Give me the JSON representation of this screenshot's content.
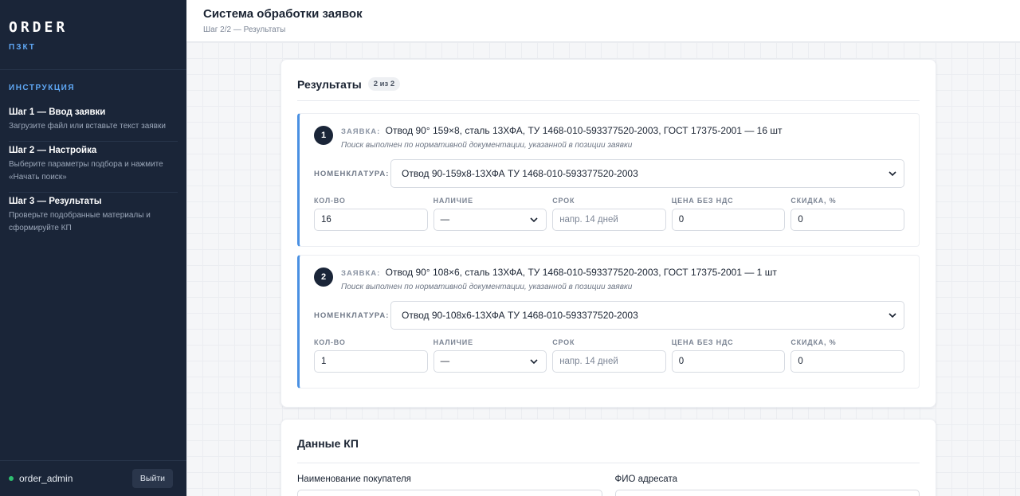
{
  "sidebar": {
    "brand_title": "ORDER",
    "brand_subtitle": "ПЗКТ",
    "instructions_title": "ИНСТРУКЦИЯ",
    "steps": [
      {
        "title": "Шаг 1 — Ввод заявки",
        "desc": "Загрузите файл или вставьте текст заявки"
      },
      {
        "title": "Шаг 2 — Настройка",
        "desc": "Выберите параметры подбора и нажмите «Начать поиск»"
      },
      {
        "title": "Шаг 3 — Результаты",
        "desc": "Проверьте подобранные материалы и сформируйте КП"
      }
    ],
    "user": "order_admin",
    "logout_label": "Выйти"
  },
  "header": {
    "title": "Система обработки заявок",
    "breadcrumb": "Шаг 2/2 — Результаты"
  },
  "results": {
    "title": "Результаты",
    "badge": "2 из 2",
    "request_label": "ЗАЯВКА:",
    "nomenclature_label": "НОМЕНКЛАТУРА:",
    "field_labels": {
      "qty": "КОЛ-ВО",
      "availability": "НАЛИЧИЕ",
      "term": "СРОК",
      "price": "ЦЕНА БЕЗ НДС",
      "discount": "СКИДКА, %"
    },
    "items": [
      {
        "num": "1",
        "request": "Отвод 90° 159×8, сталь 13ХФА, ТУ 1468-010-593377520-2003, ГОСТ 17375-2001 — 16 шт",
        "note": "Поиск выполнен по нормативной документации, указанной в позиции заявки",
        "nomenclature": "Отвод 90-159х8-13ХФА ТУ 1468-010-593377520-2003",
        "qty": "16",
        "availability": "—",
        "term_placeholder": "напр. 14 дней",
        "price": "0",
        "discount": "0"
      },
      {
        "num": "2",
        "request": "Отвод 90° 108×6, сталь 13ХФА, ТУ 1468-010-593377520-2003, ГОСТ 17375-2001 — 1 шт",
        "note": "Поиск выполнен по нормативной документации, указанной в позиции заявки",
        "nomenclature": "Отвод 90-108х6-13ХФА ТУ 1468-010-593377520-2003",
        "qty": "1",
        "availability": "—",
        "term_placeholder": "напр. 14 дней",
        "price": "0",
        "discount": "0"
      }
    ]
  },
  "kp": {
    "title": "Данные КП",
    "buyer_label": "Наименование покупателя",
    "addressee_label": "ФИО адресата"
  },
  "colors": {
    "sidebar_bg": "#1a2538",
    "accent": "#4a90e2",
    "status_online": "#2fbf71"
  }
}
